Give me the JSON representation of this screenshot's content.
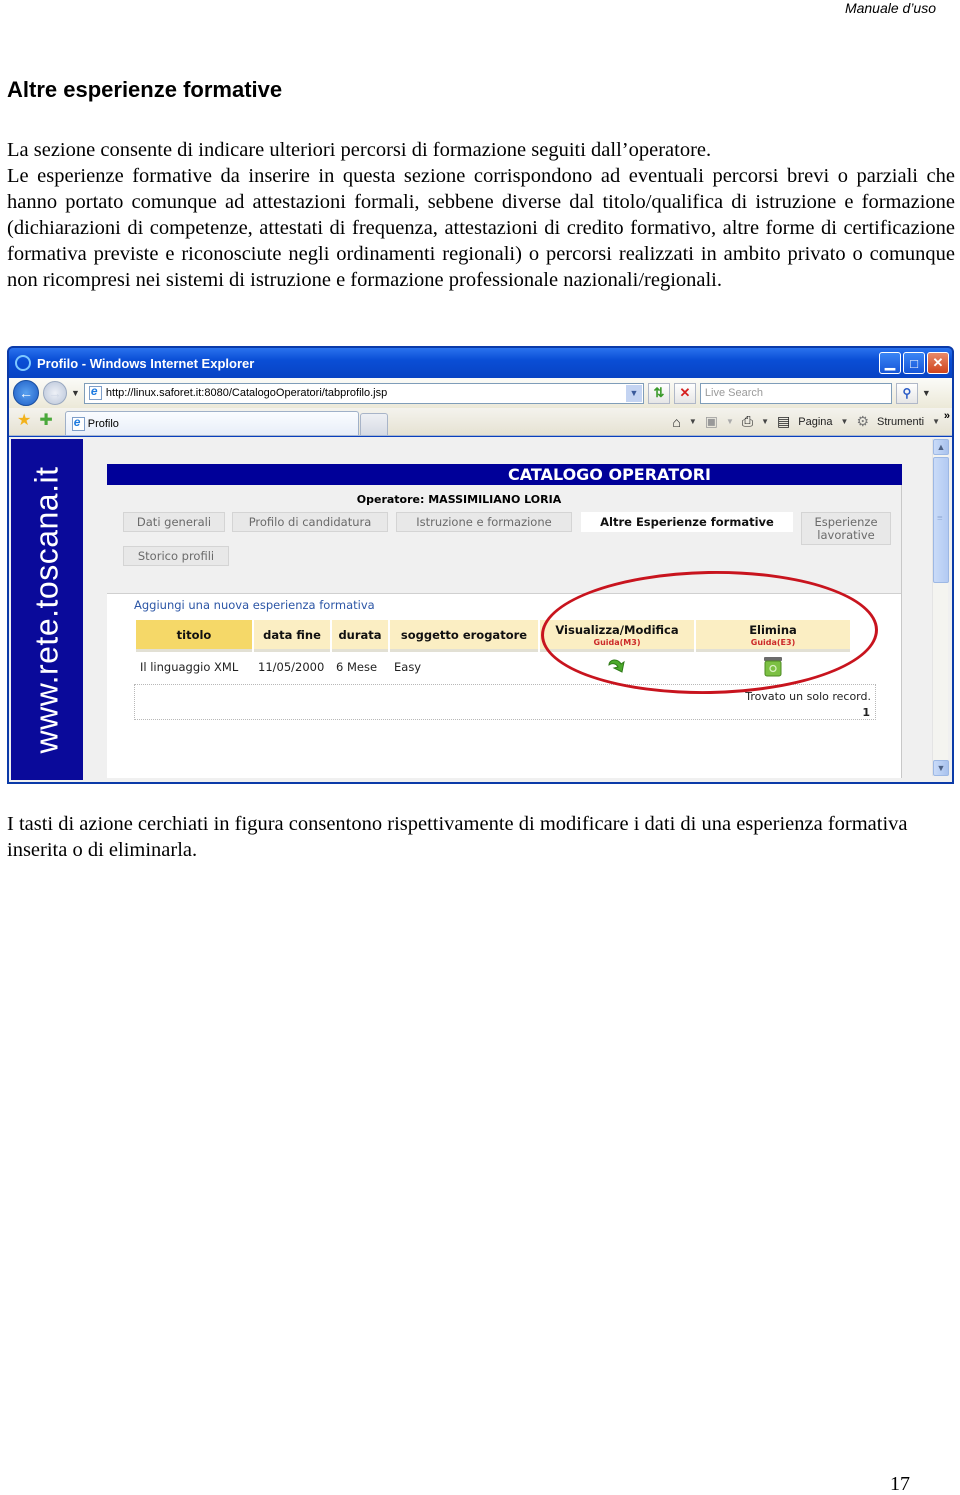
{
  "document": {
    "running_header": "Manuale d’uso",
    "section_title": "Altre esperienze formative",
    "intro_lines": [
      "La sezione consente di indicare ulteriori percorsi di formazione seguiti dall’operatore.",
      "Le esperienze formative da inserire in questa sezione corrispondono ad eventuali percorsi brevi o parziali che hanno  portato comunque ad attestazioni formali, sebbene diverse dal titolo/qualifica di istruzione e formazione (dichiarazioni di competenze, attestati di frequenza, attestazioni di credito formativo, altre forme di certificazione formativa previste e riconosciute negli ordinamenti regionali) o percorsi realizzati in ambito privato o comunque non ricompresi nei sistemi di istruzione e formazione professionale nazionali/regionali."
    ],
    "caption": "I tasti di azione cerchiati in figura consentono rispettivamente di modificare i dati di una esperienza formativa inserita o di eliminarla.",
    "page_number": "17"
  },
  "browser": {
    "window_title": "Profilo - Windows Internet Explorer",
    "address_url": "http://linux.saforet.it:8080/CatalogoOperatori/tabprofilo.jsp",
    "search_placeholder": "Live Search",
    "tab_title": "Profilo",
    "command_bar": {
      "page_label": "Pagina",
      "tools_label": "Strumenti"
    },
    "icons": [
      "ie-logo-icon",
      "back-icon",
      "forward-icon",
      "refresh-icon",
      "stop-icon",
      "search-icon",
      "favorites-star-icon",
      "add-favorites-icon",
      "home-icon",
      "feeds-icon",
      "print-icon",
      "page-icon",
      "tools-gear-icon",
      "minimize-icon",
      "maximize-icon",
      "close-icon"
    ]
  },
  "app": {
    "side_brand": "www.rete.toscana.it",
    "banner_title": "CATALOGO OPERATORI",
    "operator_label": "Operatore: MASSIMILIANO LORIA",
    "tabs": [
      {
        "label": "Dati generali",
        "active": false
      },
      {
        "label": "Profilo di candidatura",
        "active": false
      },
      {
        "label": "Istruzione e formazione",
        "active": false
      },
      {
        "label": "Altre Esperienze formative",
        "active": true
      },
      {
        "label": "Esperienze lavorative",
        "active": false
      },
      {
        "label": "Storico profili",
        "active": false
      }
    ],
    "add_link": "Aggiungi una nuova esperienza formativa",
    "table": {
      "columns": [
        {
          "label": "titolo",
          "sub": ""
        },
        {
          "label": "data fine",
          "sub": ""
        },
        {
          "label": "durata",
          "sub": ""
        },
        {
          "label": "soggetto erogatore",
          "sub": ""
        },
        {
          "label": "Visualizza/Modifica",
          "sub": "Guida(M3)"
        },
        {
          "label": "Elimina",
          "sub": "Guida(E3)"
        }
      ],
      "rows": [
        {
          "titolo": "Il linguaggio XML",
          "data_fine": "11/05/2000",
          "durata": "6 Mese",
          "soggetto_erogatore": "Easy",
          "edit_icon": "edit-arrow-icon",
          "delete_icon": "recycle-bin-icon"
        }
      ]
    },
    "pager": {
      "found_text": "Trovato un solo record.",
      "page": "1"
    },
    "colors": {
      "banner": "#000099",
      "brand_strip": "#0a0a9a",
      "header_cell": "#fbeec3",
      "sorted_header_cell": "#f5d868",
      "guide_link": "#cc2a2a",
      "add_link": "#2c56a6",
      "highlight_circle": "#c8141e"
    }
  }
}
